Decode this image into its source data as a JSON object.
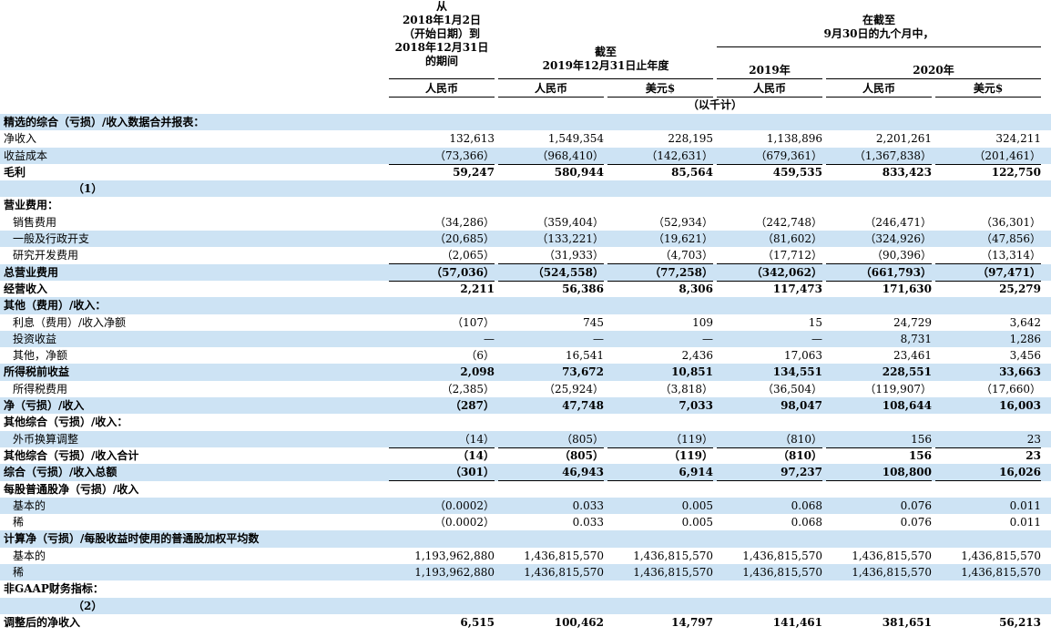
{
  "header": {
    "col1_lines": [
      "从",
      "2018年1月2日",
      "（开始日期）到",
      "2018年12月31日",
      "的期间"
    ],
    "year_end_title": [
      "截至",
      "2019年12月31日止年度"
    ],
    "nine_months_title": [
      "在截至",
      "9月30日的九个月中，"
    ],
    "year_2019": "2019年",
    "year_2020": "2020年",
    "currencies": [
      "人民币",
      "人民币",
      "美元$",
      "人民币",
      "人民币",
      "美元$"
    ],
    "unit_note": "（以千计）"
  },
  "rows": [
    {
      "label": "精选的综合（亏损）/收入数据合并报表：",
      "type": "section",
      "values": []
    },
    {
      "label": "净收入",
      "type": "plain",
      "values": [
        "132,613",
        "1,549,354",
        "228,195",
        "1,138,896",
        "2,201,261",
        "324,211"
      ]
    },
    {
      "label": "收益成本",
      "type": "plain",
      "values": [
        "（73,366）",
        "（968,410）",
        "（142,631）",
        "（679,361）",
        "（1,367,838）",
        "（201,461）"
      ]
    },
    {
      "label": "毛利",
      "type": "bold",
      "values": [
        "59,247",
        "580,944",
        "85,564",
        "459,535",
        "833,423",
        "122,750"
      ]
    },
    {
      "label": "（1）",
      "type": "note",
      "values": []
    },
    {
      "label": "营业费用：",
      "type": "section",
      "values": []
    },
    {
      "label": "销售费用",
      "type": "indent",
      "values": [
        "（34,286）",
        "（359,404）",
        "（52,934）",
        "（242,748）",
        "（246,471）",
        "（36,301）"
      ]
    },
    {
      "label": "一般及行政开支",
      "type": "indent",
      "values": [
        "（20,685）",
        "（133,221）",
        "（19,621）",
        "（81,602）",
        "（324,926）",
        "（47,856）"
      ]
    },
    {
      "label": "研究开发费用",
      "type": "indent",
      "values": [
        "（2,065）",
        "（31,933）",
        "（4,703）",
        "（17,712）",
        "（90,396）",
        "（13,314）"
      ]
    },
    {
      "label": "总营业费用",
      "type": "bold",
      "values": [
        "（57,036）",
        "（524,558）",
        "（77,258）",
        "（342,062）",
        "（661,793）",
        "（97,471）"
      ]
    },
    {
      "label": "经营收入",
      "type": "bold",
      "values": [
        "2,211",
        "56,386",
        "8,306",
        "117,473",
        "171,630",
        "25,279"
      ]
    },
    {
      "label": "其他（费用）/收入：",
      "type": "section",
      "values": []
    },
    {
      "label": "利息（费用）/收入净额",
      "type": "indent",
      "values": [
        "（107）",
        "745",
        "109",
        "15",
        "24,729",
        "3,642"
      ]
    },
    {
      "label": "投资收益",
      "type": "indent",
      "values": [
        "—",
        "—",
        "—",
        "—",
        "8,731",
        "1,286"
      ]
    },
    {
      "label": "其他，净额",
      "type": "indent",
      "values": [
        "（6）",
        "16,541",
        "2,436",
        "17,063",
        "23,461",
        "3,456"
      ]
    },
    {
      "label": "所得税前收益",
      "type": "bold",
      "values": [
        "2,098",
        "73,672",
        "10,851",
        "134,551",
        "228,551",
        "33,663"
      ]
    },
    {
      "label": "所得税费用",
      "type": "indent",
      "values": [
        "（2,385）",
        "（25,924）",
        "（3,818）",
        "（36,504）",
        "（119,907）",
        "（17,660）"
      ]
    },
    {
      "label": "净（亏损）/收入",
      "type": "bold",
      "values": [
        "（287）",
        "47,748",
        "7,033",
        "98,047",
        "108,644",
        "16,003"
      ]
    },
    {
      "label": "其他综合（亏损）/收入：",
      "type": "section",
      "values": []
    },
    {
      "label": "外币换算调整",
      "type": "indent",
      "values": [
        "（14）",
        "（805）",
        "（119）",
        "（810）",
        "156",
        "23"
      ]
    },
    {
      "label": "其他综合（亏损）/收入合计",
      "type": "bold",
      "values": [
        "（14）",
        "（805）",
        "（119）",
        "（810）",
        "156",
        "23"
      ]
    },
    {
      "label": "综合（亏损）/收入总额",
      "type": "bold",
      "values": [
        "（301）",
        "46,943",
        "6,914",
        "97,237",
        "108,800",
        "16,026"
      ]
    },
    {
      "label": "每股普通股净（亏损）/收入",
      "type": "section",
      "values": []
    },
    {
      "label": "基本的",
      "type": "indent",
      "values": [
        "（0.0002）",
        "0.033",
        "0.005",
        "0.068",
        "0.076",
        "0.011"
      ]
    },
    {
      "label": "稀",
      "type": "indent",
      "values": [
        "（0.0002）",
        "0.033",
        "0.005",
        "0.068",
        "0.076",
        "0.011"
      ]
    },
    {
      "label": "计算净（亏损）/每股收益时使用的普通股加权平均数",
      "type": "section",
      "values": []
    },
    {
      "label": "基本的",
      "type": "indent",
      "values": [
        "1,193,962,880",
        "1,436,815,570",
        "1,436,815,570",
        "1,436,815,570",
        "1,436,815,570",
        "1,436,815,570"
      ]
    },
    {
      "label": "稀",
      "type": "indent",
      "values": [
        "1,193,962,880",
        "1,436,815,570",
        "1,436,815,570",
        "1,436,815,570",
        "1,436,815,570",
        "1,436,815,570"
      ]
    },
    {
      "label": "非GAAP财务指标：",
      "type": "section",
      "values": []
    },
    {
      "label": "（2）",
      "type": "note",
      "values": []
    },
    {
      "label": "调整后的净收入",
      "type": "bold",
      "values": [
        "6,515",
        "100,462",
        "14,797",
        "141,461",
        "381,651",
        "56,213"
      ]
    }
  ]
}
